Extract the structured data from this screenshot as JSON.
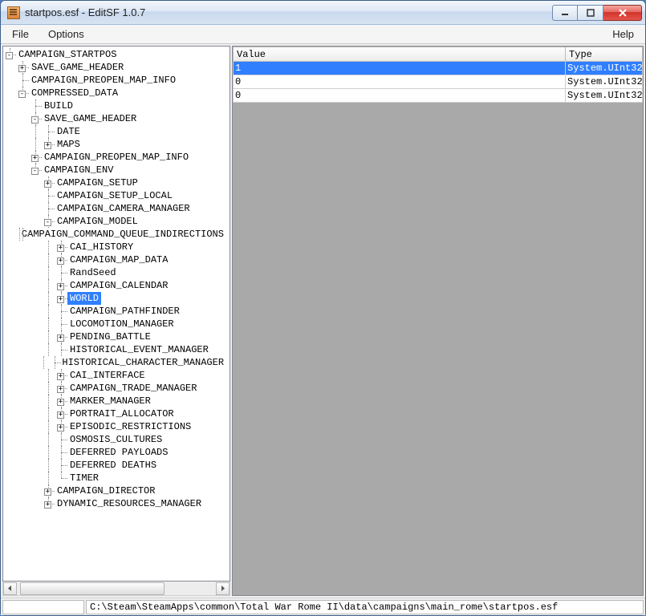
{
  "titlebar": {
    "title": "startpos.esf - EditSF 1.0.7"
  },
  "menu": {
    "file": "File",
    "options": "Options",
    "help": "Help"
  },
  "tree": {
    "selected_index": 19,
    "nodes": [
      {
        "d": 0,
        "t": "-",
        "label": "CAMPAIGN_STARTPOS"
      },
      {
        "d": 1,
        "t": "+",
        "label": "SAVE_GAME_HEADER"
      },
      {
        "d": 1,
        "t": "",
        "label": "CAMPAIGN_PREOPEN_MAP_INFO"
      },
      {
        "d": 1,
        "t": "-",
        "label": "COMPRESSED_DATA"
      },
      {
        "d": 2,
        "t": "",
        "label": "BUILD"
      },
      {
        "d": 2,
        "t": "-",
        "label": "SAVE_GAME_HEADER"
      },
      {
        "d": 3,
        "t": "",
        "label": "DATE"
      },
      {
        "d": 3,
        "t": "+",
        "label": "MAPS"
      },
      {
        "d": 2,
        "t": "+",
        "label": "CAMPAIGN_PREOPEN_MAP_INFO"
      },
      {
        "d": 2,
        "t": "-",
        "label": "CAMPAIGN_ENV"
      },
      {
        "d": 3,
        "t": "+",
        "label": "CAMPAIGN_SETUP"
      },
      {
        "d": 3,
        "t": "",
        "label": "CAMPAIGN_SETUP_LOCAL"
      },
      {
        "d": 3,
        "t": "",
        "label": "CAMPAIGN_CAMERA_MANAGER"
      },
      {
        "d": 3,
        "t": "-",
        "label": "CAMPAIGN_MODEL"
      },
      {
        "d": 4,
        "t": "",
        "label": "CAMPAIGN_COMMAND_QUEUE_INDIRECTIONS"
      },
      {
        "d": 4,
        "t": "+",
        "label": "CAI_HISTORY"
      },
      {
        "d": 4,
        "t": "+",
        "label": "CAMPAIGN_MAP_DATA"
      },
      {
        "d": 4,
        "t": "",
        "label": "RandSeed"
      },
      {
        "d": 4,
        "t": "+",
        "label": "CAMPAIGN_CALENDAR"
      },
      {
        "d": 4,
        "t": "+",
        "label": "WORLD"
      },
      {
        "d": 4,
        "t": "",
        "label": "CAMPAIGN_PATHFINDER"
      },
      {
        "d": 4,
        "t": "",
        "label": "LOCOMOTION_MANAGER"
      },
      {
        "d": 4,
        "t": "+",
        "label": "PENDING_BATTLE"
      },
      {
        "d": 4,
        "t": "",
        "label": "HISTORICAL_EVENT_MANAGER"
      },
      {
        "d": 4,
        "t": "",
        "label": "HISTORICAL_CHARACTER_MANAGER"
      },
      {
        "d": 4,
        "t": "+",
        "label": "CAI_INTERFACE"
      },
      {
        "d": 4,
        "t": "+",
        "label": "CAMPAIGN_TRADE_MANAGER"
      },
      {
        "d": 4,
        "t": "+",
        "label": "MARKER_MANAGER"
      },
      {
        "d": 4,
        "t": "+",
        "label": "PORTRAIT_ALLOCATOR"
      },
      {
        "d": 4,
        "t": "+",
        "label": "EPISODIC_RESTRICTIONS"
      },
      {
        "d": 4,
        "t": "",
        "label": "OSMOSIS_CULTURES"
      },
      {
        "d": 4,
        "t": "",
        "label": "DEFERRED PAYLOADS"
      },
      {
        "d": 4,
        "t": "",
        "label": "DEFERRED DEATHS"
      },
      {
        "d": 4,
        "t": "",
        "label": "TIMER"
      },
      {
        "d": 3,
        "t": "+",
        "label": "CAMPAIGN_DIRECTOR"
      },
      {
        "d": 3,
        "t": "+",
        "label": "DYNAMIC_RESOURCES_MANAGER"
      }
    ]
  },
  "grid": {
    "columns": {
      "value": "Value",
      "type": "Type"
    },
    "col_widths": {
      "value": 410,
      "type": 95
    },
    "rows": [
      {
        "value": "1",
        "type": "System.UInt32",
        "selected": true
      },
      {
        "value": "0",
        "type": "System.UInt32",
        "selected": false
      },
      {
        "value": "0",
        "type": "System.UInt32",
        "selected": false
      }
    ]
  },
  "status": {
    "path": "C:\\Steam\\SteamApps\\common\\Total War Rome II\\data\\campaigns\\main_rome\\startpos.esf"
  }
}
